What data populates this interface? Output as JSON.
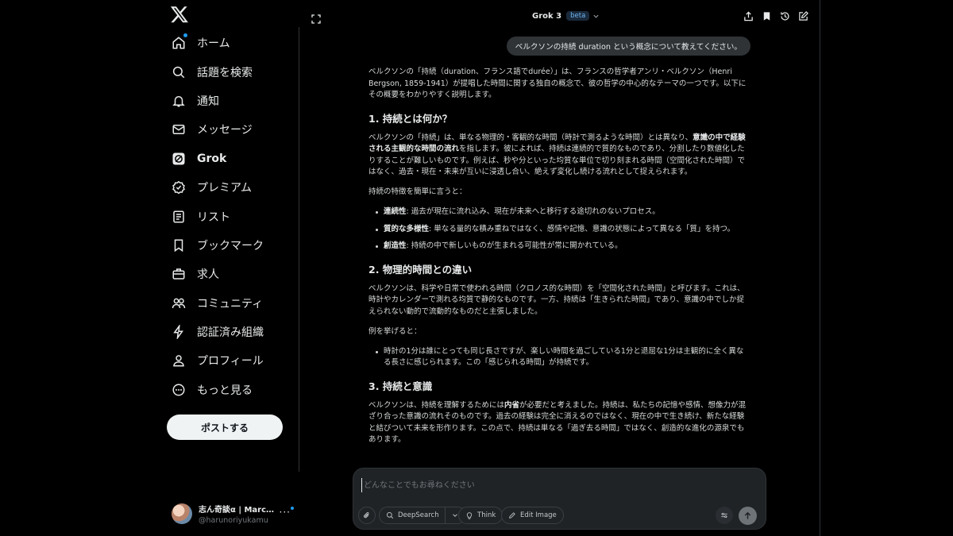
{
  "sidebar": {
    "items": [
      {
        "label": "ホーム",
        "icon": "home-icon"
      },
      {
        "label": "話題を検索",
        "icon": "search-icon"
      },
      {
        "label": "通知",
        "icon": "bell-icon"
      },
      {
        "label": "メッセージ",
        "icon": "mail-icon"
      },
      {
        "label": "Grok",
        "icon": "grok-icon"
      },
      {
        "label": "プレミアム",
        "icon": "premium-icon"
      },
      {
        "label": "リスト",
        "icon": "list-icon"
      },
      {
        "label": "ブックマーク",
        "icon": "bookmark-icon"
      },
      {
        "label": "求人",
        "icon": "briefcase-icon"
      },
      {
        "label": "コミュニティ",
        "icon": "community-icon"
      },
      {
        "label": "認証済み組織",
        "icon": "lightning-icon"
      },
      {
        "label": "プロフィール",
        "icon": "person-icon"
      },
      {
        "label": "もっと見る",
        "icon": "more-circle-icon"
      }
    ],
    "post_button": "ポストする",
    "account": {
      "name": "志ん奇談α | Marc M…",
      "handle": "@harunoriyukamu",
      "more": "···"
    }
  },
  "header": {
    "model": "Grok 3",
    "badge": "beta"
  },
  "chat": {
    "user_message": "ベルクソンの持続 duration という概念について教えてください。",
    "answer": {
      "intro": "ベルクソンの「持続（duration、フランス語でdurée）」は、フランスの哲学者アンリ・ベルクソン（Henri Bergson, 1859-1941）が提唱した時間に関する独自の概念で、彼の哲学の中心的なテーマの一つです。以下にその概要をわかりやすく説明します。",
      "h1": "1. 持続とは何か？",
      "s1_p1_a": "ベルクソンの「持続」は、単なる物理的・客観的な時間（時計で測るような時間）とは異なり、",
      "s1_p1_bold": "意識の中で経験される主観的な時間の流れ",
      "s1_p1_b": "を指します。彼によれば、持続は連続的で質的なものであり、分割したり数値化したりすることが難しいものです。例えば、秒や分といった均質な単位で切り刻まれる時間（空間化された時間）ではなく、過去・現在・未来が互いに浸透し合い、絶えず変化し続ける流れとして捉えられます。",
      "s1_p2": "持続の特徴を簡単に言うと：",
      "bullets": [
        {
          "term": "連続性",
          "text": ": 過去が現在に流れ込み、現在が未来へと移行する途切れのないプロセス。"
        },
        {
          "term": "質的な多様性",
          "text": ": 単なる量的な積み重ねではなく、感情や記憶、意識の状態によって異なる「質」を持つ。"
        },
        {
          "term": "創造性",
          "text": ": 持続の中で新しいものが生まれる可能性が常に開かれている。"
        }
      ],
      "h2": "2. 物理的時間との違い",
      "s2_p1": "ベルクソンは、科学や日常で使われる時間（クロノス的な時間）を「空間化された時間」と呼びます。これは、時計やカレンダーで測れる均質で静的なものです。一方、持続は「生きられた時間」であり、意識の中でしか捉えられない動的で流動的なものだと主張しました。",
      "s2_p2": "例を挙げると：",
      "s2_bullet": "時計の1分は誰にとっても同じ長さですが、楽しい時間を過ごしている1分と退屈な1分は主観的に全く異なる長さに感じられます。この「感じられる時間」が持続です。",
      "h3": "3. 持続と意識",
      "s3_p1_a": "ベルクソンは、持続を理解するためには",
      "s3_p1_bold": "内省",
      "s3_p1_b": "が必要だと考えました。持続は、私たちの記憶や感情、想像力が混ざり合った意識の流れそのものです。過去の経験は完全に消えるのではなく、現在の中で生き続け、新たな経験と結びついて未来を形作ります。この点で、持続は単なる「過ぎ去る時間」ではなく、創造的な進化の源泉でもあります。"
    }
  },
  "composer": {
    "placeholder": "どんなことでもお尋ねください",
    "deepsearch": "DeepSearch",
    "think": "Think",
    "edit_image": "Edit Image"
  }
}
